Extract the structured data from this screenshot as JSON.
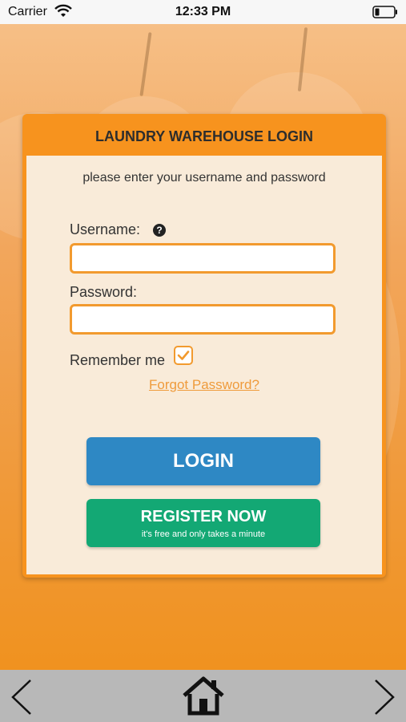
{
  "status_bar": {
    "carrier": "Carrier",
    "time": "12:33 PM",
    "icons": [
      "wifi-icon",
      "battery-icon"
    ]
  },
  "login_card": {
    "title": "LAUNDRY WAREHOUSE LOGIN",
    "intro": "please enter your username and password",
    "username_label": "Username:",
    "username_value": "",
    "password_label": "Password:",
    "password_value": "",
    "remember_label": "Remember me",
    "remember_checked": true,
    "forgot_link": "Forgot Password?",
    "login_button": "LOGIN",
    "register_button": "REGISTER NOW",
    "register_subtext": "it's free and only takes a minute"
  },
  "bottom_nav": {
    "icons": [
      "chevron-left-icon",
      "home-icon",
      "chevron-right-icon"
    ]
  },
  "colors": {
    "accent": "#f7931e",
    "login": "#2e88c4",
    "register": "#13a874",
    "link": "#ef9b3c"
  }
}
